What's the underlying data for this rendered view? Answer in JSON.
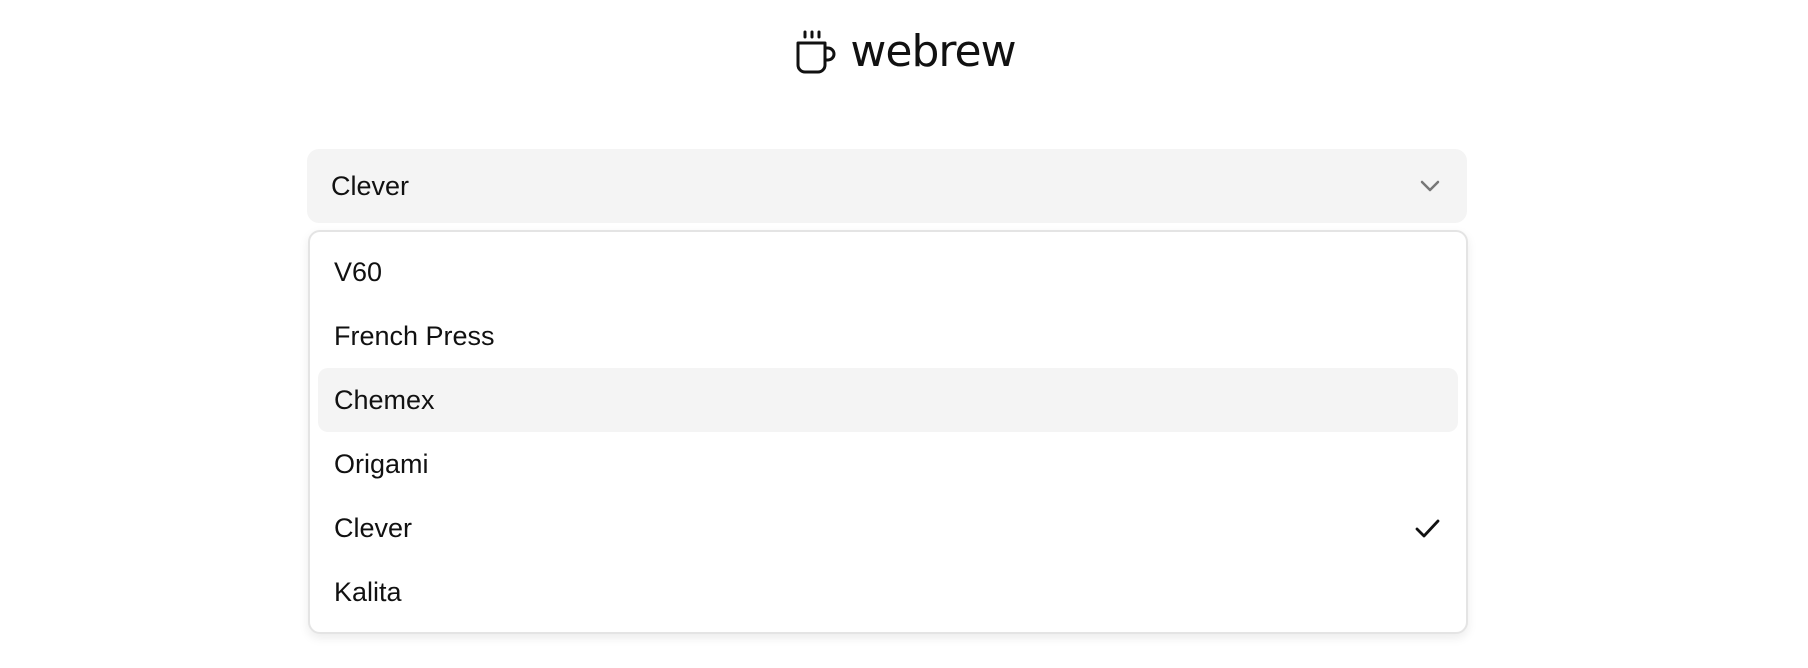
{
  "brand": {
    "icon": "coffee-cup-icon",
    "name": "webrew"
  },
  "select": {
    "value": "Clever",
    "icon": "chevron-down-icon"
  },
  "dropdown": {
    "options": [
      {
        "label": "V60",
        "highlighted": false,
        "selected": false
      },
      {
        "label": "French Press",
        "highlighted": false,
        "selected": false
      },
      {
        "label": "Chemex",
        "highlighted": true,
        "selected": false
      },
      {
        "label": "Origami",
        "highlighted": false,
        "selected": false
      },
      {
        "label": "Clever",
        "highlighted": false,
        "selected": true
      },
      {
        "label": "Kalita",
        "highlighted": false,
        "selected": false
      }
    ],
    "selected_icon": "check-icon"
  },
  "colors": {
    "text": "#111111",
    "trigger_background": "#f4f4f4",
    "highlight_background": "#f4f4f4",
    "dropdown_border": "#e4e4e4",
    "chevron": "#777777"
  }
}
